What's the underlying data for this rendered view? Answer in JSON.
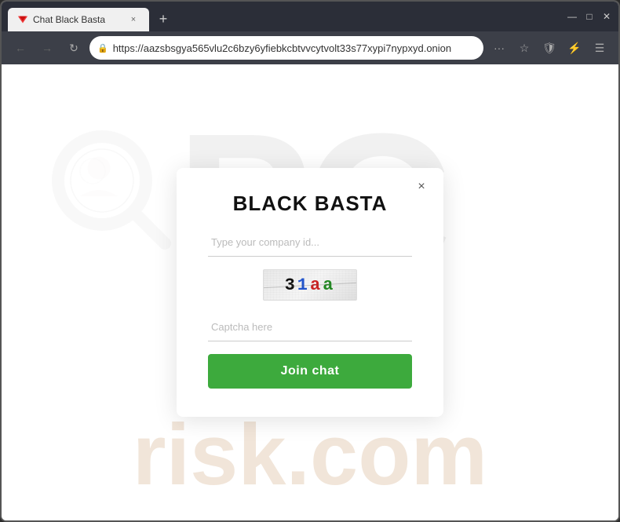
{
  "browser": {
    "tab": {
      "title": "Chat Black Basta",
      "close_label": "×"
    },
    "new_tab_label": "+",
    "window_controls": {
      "minimize": "—",
      "maximize": "□",
      "close": "✕"
    },
    "nav": {
      "back_label": "←",
      "forward_label": "→",
      "reload_label": "↻",
      "url": "https://aazsbsgya565vlu2c6bzy6yfiebkcbtvvcytvolt33s77xypi7nypxyd.onion",
      "more_label": "···",
      "star_label": "☆",
      "shield_label": "🛡",
      "extension_label": "⚡",
      "menu_label": "☰"
    }
  },
  "page": {
    "watermark_pc": "PC",
    "watermark_risk": "risk.com"
  },
  "modal": {
    "close_label": "×",
    "title": "BLACK BASTA",
    "company_id_placeholder": "Type your company id...",
    "captcha_placeholder": "Captcha here",
    "captcha_display": "31aa",
    "join_button_label": "Join chat"
  }
}
